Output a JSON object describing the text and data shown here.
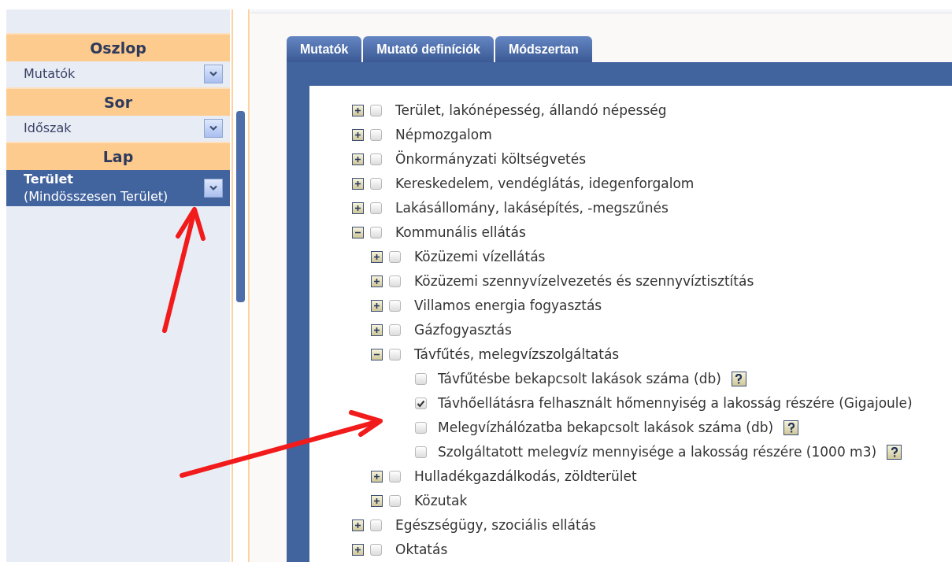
{
  "sidebar": {
    "sections": [
      {
        "title": "Oszlop",
        "items": [
          {
            "label": "Mutatók",
            "selected": false
          }
        ]
      },
      {
        "title": "Sor",
        "items": [
          {
            "label": "Időszak",
            "selected": false
          }
        ]
      },
      {
        "title": "Lap",
        "items": [
          {
            "label": "Terület",
            "sublabel": "(Mindösszesen Terület)",
            "selected": true
          }
        ]
      }
    ]
  },
  "tabs": [
    {
      "label": "Mutatók"
    },
    {
      "label": "Mutató definíciók"
    },
    {
      "label": "Módszertan"
    }
  ],
  "tree": [
    {
      "kind": "group",
      "label": "Terület, lakónépesség, állandó népesség",
      "expanded": false,
      "checked": false
    },
    {
      "kind": "group",
      "label": "Népmozgalom",
      "expanded": false,
      "checked": false
    },
    {
      "kind": "group",
      "label": "Önkormányzati költségvetés",
      "expanded": false,
      "checked": false
    },
    {
      "kind": "group",
      "label": "Kereskedelem, vendéglátás, idegenforgalom",
      "expanded": false,
      "checked": false
    },
    {
      "kind": "group",
      "label": "Lakásállomány, lakásépítés, -megszűnés",
      "expanded": false,
      "checked": false
    },
    {
      "kind": "group",
      "label": "Kommunális ellátás",
      "expanded": true,
      "checked": false,
      "children": [
        {
          "kind": "group",
          "label": "Közüzemi vízellátás",
          "expanded": false,
          "checked": false
        },
        {
          "kind": "group",
          "label": "Közüzemi szennyvízelvezetés és szennyvíztisztítás",
          "expanded": false,
          "checked": false
        },
        {
          "kind": "group",
          "label": "Villamos energia fogyasztás",
          "expanded": false,
          "checked": false
        },
        {
          "kind": "group",
          "label": "Gázfogyasztás",
          "expanded": false,
          "checked": false
        },
        {
          "kind": "group",
          "label": "Távfűtés, melegvízszolgáltatás",
          "expanded": true,
          "checked": false,
          "children": [
            {
              "kind": "indicator",
              "label": "Távfűtésbe bekapcsolt lakások száma (db)",
              "checked": false,
              "help": true
            },
            {
              "kind": "indicator",
              "label": "Távhőellátásra felhasznált hőmennyiség a lakosság részére (Gigajoule)",
              "checked": true,
              "help": false
            },
            {
              "kind": "indicator",
              "label": "Melegvízhálózatba bekapcsolt lakások száma (db)",
              "checked": false,
              "help": true
            },
            {
              "kind": "indicator",
              "label": "Szolgáltatott melegvíz mennyisége a lakosság részére (1000 m3)",
              "checked": false,
              "help": true
            }
          ]
        },
        {
          "kind": "group",
          "label": "Hulladékgazdálkodás, zöldterület",
          "expanded": false,
          "checked": false
        },
        {
          "kind": "group",
          "label": "Közutak",
          "expanded": false,
          "checked": false
        }
      ]
    },
    {
      "kind": "group",
      "label": "Egészségügy, szociális ellátás",
      "expanded": false,
      "checked": false
    },
    {
      "kind": "group",
      "label": "Oktatás",
      "expanded": false,
      "checked": false
    }
  ]
}
